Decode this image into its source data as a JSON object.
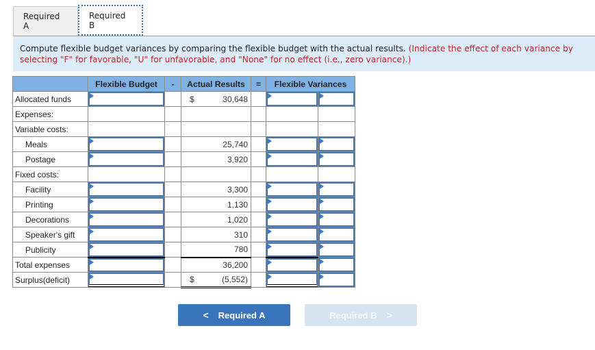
{
  "tabs": [
    {
      "label": "Required A",
      "active": false
    },
    {
      "label": "Required B",
      "active": true
    }
  ],
  "instructions": {
    "text": "Compute flexible budget variances by comparing the flexible budget with the actual  results. ",
    "note": "(Indicate the effect of each variance by selecting \"F\" for favorable, \"U\" for unfavorable, and \"None\" for no effect (i.e., zero variance).)"
  },
  "table": {
    "headers": {
      "label": "",
      "flexible_budget": "Flexible Budget",
      "minus": "-",
      "actual_results": "Actual Results",
      "equals": "=",
      "flexible_variances": "Flexible Variances"
    },
    "rows": [
      {
        "label": "Allocated funds",
        "currency": "$",
        "actual": "30,648",
        "inputs": true
      },
      {
        "label": "Expenses:",
        "currency": "",
        "actual": "",
        "inputs": false
      },
      {
        "label": "Variable costs:",
        "currency": "",
        "actual": "",
        "inputs": false
      },
      {
        "label": "Meals",
        "currency": "",
        "actual": "25,740",
        "inputs": true
      },
      {
        "label": "Postage",
        "currency": "",
        "actual": "3,920",
        "inputs": true
      },
      {
        "label": "Fixed costs:",
        "currency": "",
        "actual": "",
        "inputs": false
      },
      {
        "label": "Facility",
        "currency": "",
        "actual": "3,300",
        "inputs": true
      },
      {
        "label": "Printing",
        "currency": "",
        "actual": "1,130",
        "inputs": true
      },
      {
        "label": "Decorations",
        "currency": "",
        "actual": "1,020",
        "inputs": true
      },
      {
        "label": "Speaker's gift",
        "currency": "",
        "actual": "310",
        "inputs": true
      },
      {
        "label": "Publicity",
        "currency": "",
        "actual": "780",
        "inputs": true
      },
      {
        "label": "Total expenses",
        "currency": "",
        "actual": "36,200",
        "inputs": true
      },
      {
        "label": "Surplus(deficit)",
        "currency": "$",
        "actual": "(5,552)",
        "inputs": true
      }
    ]
  },
  "nav": {
    "prev_label": "Required A",
    "next_label": "Required B",
    "prev_icon": "chevron-left-icon",
    "next_icon": "chevron-right-icon",
    "prev_glyph": "<",
    "next_glyph": ">"
  },
  "colors": {
    "header_bg": "#7fb1e3",
    "instruction_bg": "#dcecf8",
    "instruction_note": "#c0282d",
    "primary_button": "#3a75bb",
    "disabled_button": "#d6e3f1",
    "input_border": "#4a78ad"
  }
}
